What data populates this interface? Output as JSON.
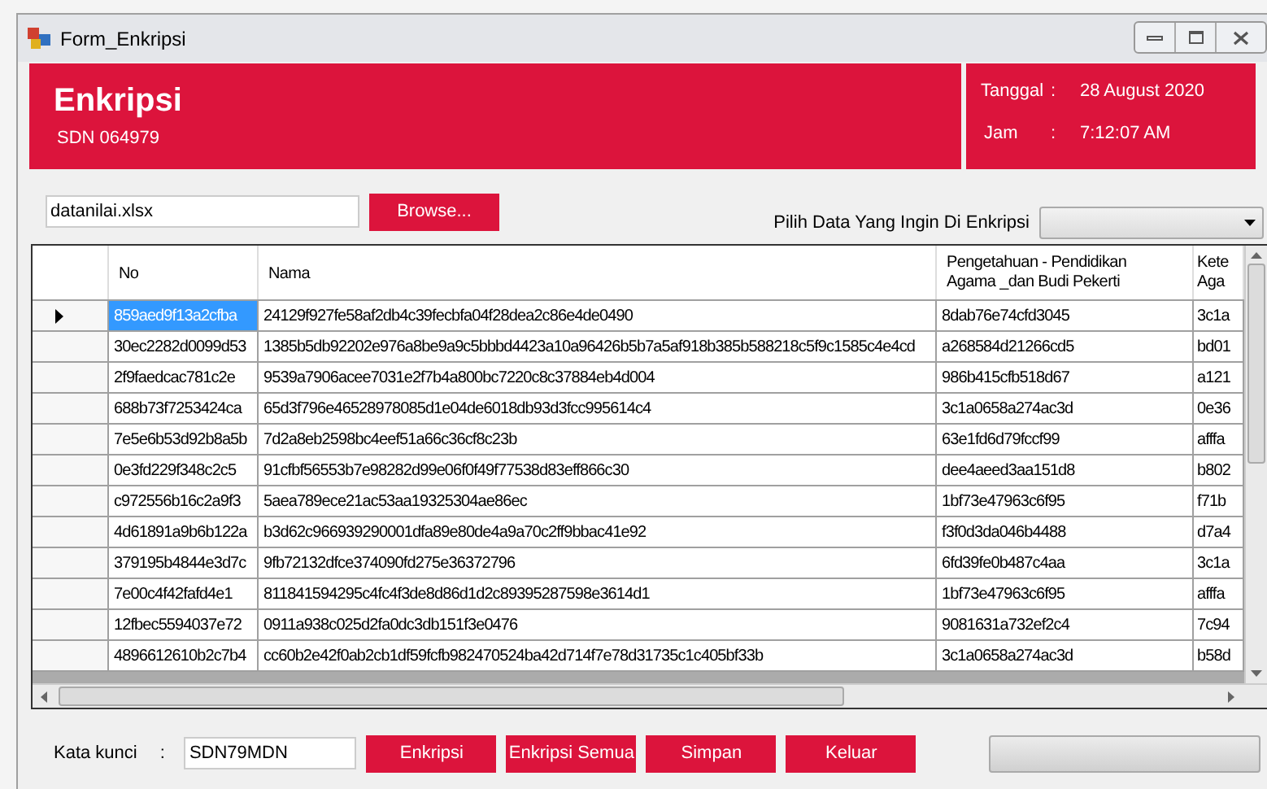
{
  "window": {
    "title": "Form_Enkripsi"
  },
  "header": {
    "title": "Enkripsi",
    "subtitle": "SDN 064979",
    "date_label": "Tanggal",
    "date_sep": ":",
    "date": "28 August 2020",
    "time_label": "Jam",
    "time_sep": ":",
    "time": "7:12:07 AM"
  },
  "file": {
    "value": "datanilai.xlsx",
    "browse": "Browse..."
  },
  "select": {
    "label": "Pilih Data Yang Ingin Di Enkripsi"
  },
  "table": {
    "columns": [
      "No",
      "Nama",
      "Pengetahuan - Pendidikan Agama _dan Budi Pekerti",
      "Kete Aga"
    ],
    "rows": [
      {
        "selected": true,
        "cells": [
          "859aed9f13a2cfba",
          "24129f927fe58af2db4c39fecbfa04f28dea2c86e4de0490",
          "8dab76e74cfd3045",
          "3c1a"
        ]
      },
      {
        "selected": false,
        "cells": [
          "30ec2282d0099d53",
          "1385b5db92202e976a8be9a9c5bbbd4423a10a96426b5b7a5af918b385b588218c5f9c1585c4e4cd",
          "a268584d21266cd5",
          "bd01"
        ]
      },
      {
        "selected": false,
        "cells": [
          "2f9faedcac781c2e",
          "9539a7906acee7031e2f7b4a800bc7220c8c37884eb4d004",
          "986b415cfb518d67",
          "a121"
        ]
      },
      {
        "selected": false,
        "cells": [
          "688b73f7253424ca",
          "65d3f796e46528978085d1e04de6018db93d3fcc995614c4",
          "3c1a0658a274ac3d",
          "0e36"
        ]
      },
      {
        "selected": false,
        "cells": [
          "7e5e6b53d92b8a5b",
          "7d2a8eb2598bc4eef51a66c36cf8c23b",
          "63e1fd6d79fccf99",
          "afffa"
        ]
      },
      {
        "selected": false,
        "cells": [
          "0e3fd229f348c2c5",
          "91cfbf56553b7e98282d99e06f0f49f77538d83eff866c30",
          "dee4aeed3aa151d8",
          "b802"
        ]
      },
      {
        "selected": false,
        "cells": [
          "c972556b16c2a9f3",
          "5aea789ece21ac53aa19325304ae86ec",
          "1bf73e47963c6f95",
          "f71b"
        ]
      },
      {
        "selected": false,
        "cells": [
          "4d61891a9b6b122a",
          "b3d62c966939290001dfa89e80de4a9a70c2ff9bbac41e92",
          "f3f0d3da046b4488",
          "d7a4"
        ]
      },
      {
        "selected": false,
        "cells": [
          "379195b4844e3d7c",
          "9fb72132dfce374090fd275e36372796",
          "6fd39fe0b487c4aa",
          "3c1a"
        ]
      },
      {
        "selected": false,
        "cells": [
          "7e00c4f42fafd4e1",
          "811841594295c4fc4f3de8d86d1d2c89395287598e3614d1",
          "1bf73e47963c6f95",
          "afffa"
        ]
      },
      {
        "selected": false,
        "cells": [
          "12fbec5594037e72",
          "0911a938c025d2fa0dc3db151f3e0476",
          "9081631a732ef2c4",
          "7c94"
        ]
      },
      {
        "selected": false,
        "cells": [
          "4896612610b2c7b4",
          "cc60b2e42f0ab2cb1df59fcfb982470524ba42d714f7e78d31735c1c405bf33b",
          "3c1a0658a274ac3d",
          "b58d"
        ]
      }
    ]
  },
  "footer": {
    "key_label": "Kata kunci",
    "key_sep": ":",
    "key_value": "SDN79MDN",
    "buttons": [
      "Enkripsi",
      "Enkripsi Semua",
      "Simpan",
      "Keluar"
    ],
    "progress": {
      "level": 0
    }
  }
}
